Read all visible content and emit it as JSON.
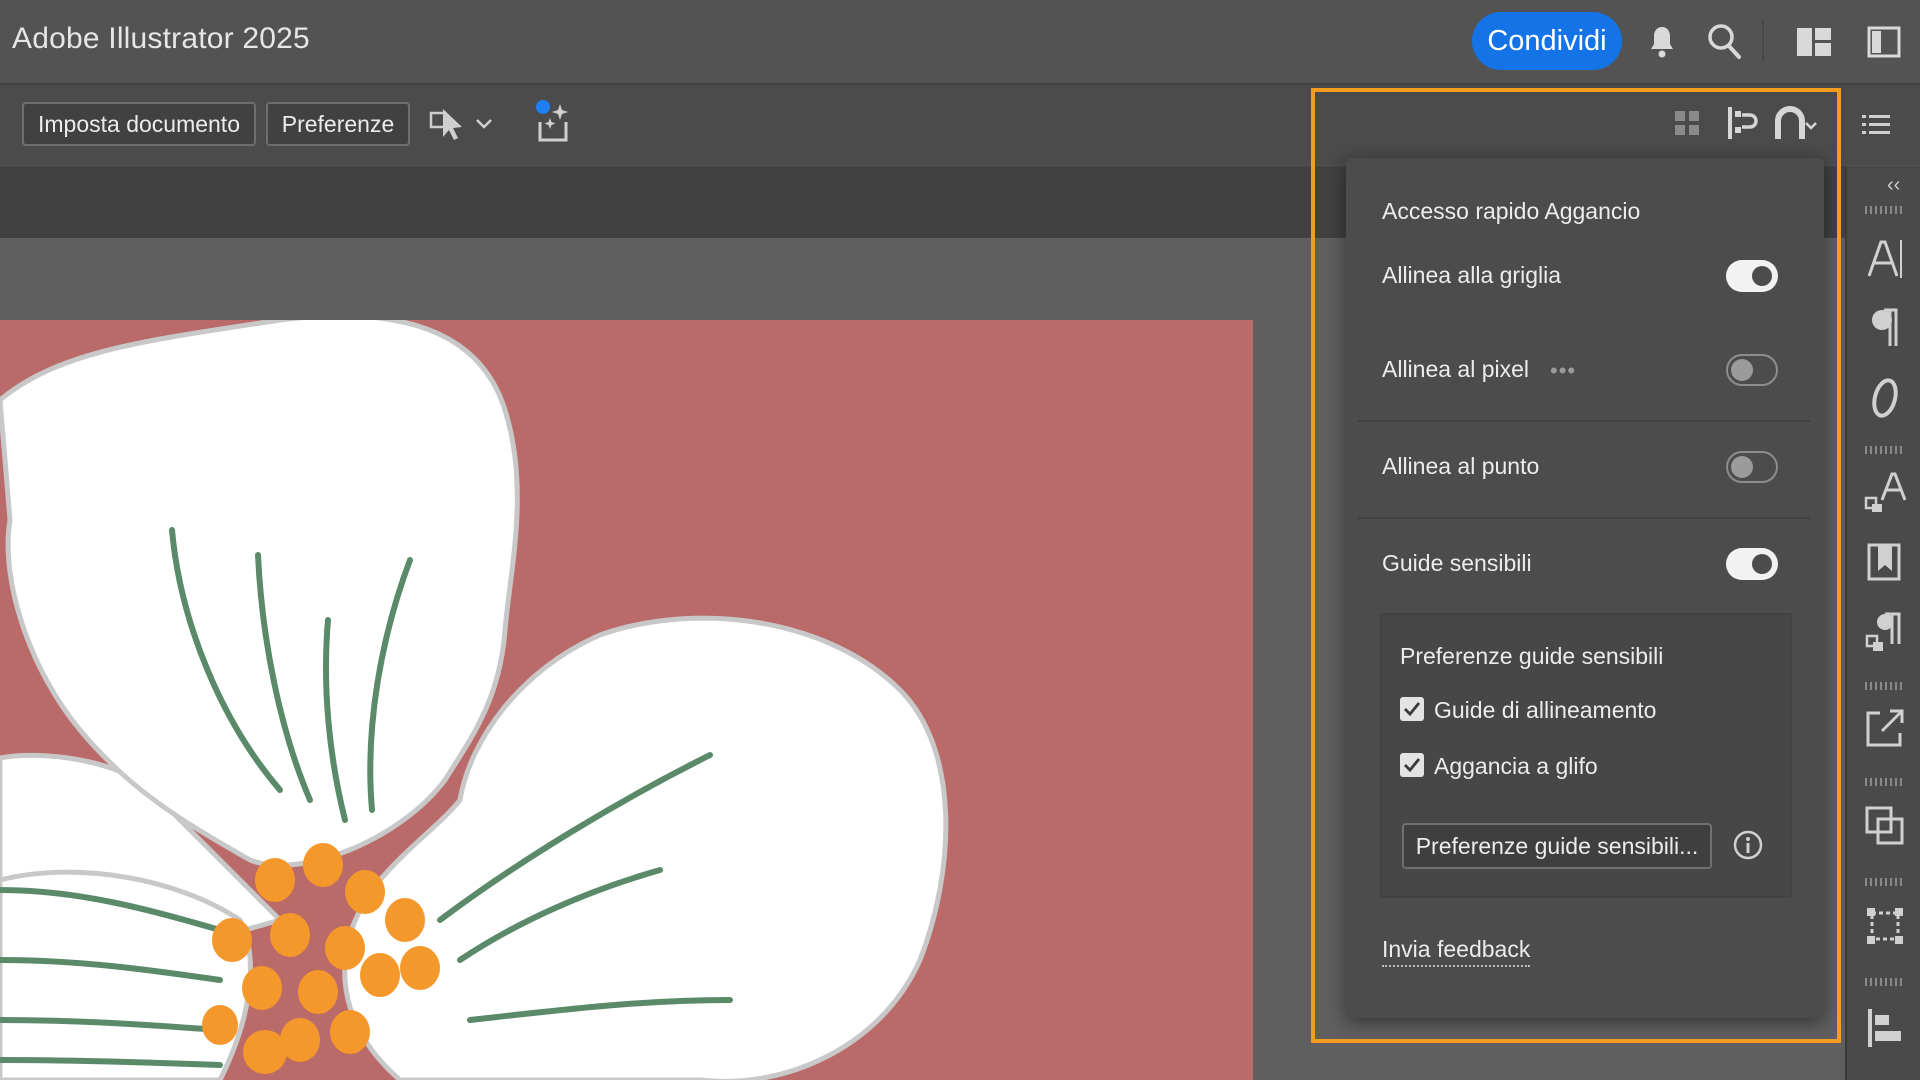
{
  "app": {
    "title": "Adobe Illustrator 2025"
  },
  "titlebar": {
    "share_label": "Condividi",
    "icons": [
      "bell-icon",
      "search-icon",
      "workspace-layout-icon",
      "panel-toggle-icon"
    ]
  },
  "controlbar": {
    "doc_setup_label": "Imposta documento",
    "prefs_label": "Preferenze",
    "icons": [
      "select-similar-icon",
      "chevron-down-icon",
      "generative-recolor-icon",
      "snap-grid-icon",
      "snap-align-icon",
      "magnet-snap-icon",
      "properties-list-icon"
    ]
  },
  "snap_popup": {
    "title": "Accesso rapido Aggancio",
    "items": [
      {
        "label": "Allinea alla griglia",
        "on": true
      },
      {
        "label": "Allinea al pixel",
        "on": false
      },
      {
        "label": "Allinea al punto",
        "on": false
      },
      {
        "label": "Guide sensibili",
        "on": true
      }
    ],
    "smart_guides": {
      "title": "Preferenze guide sensibili",
      "options": [
        {
          "label": "Guide di allineamento",
          "checked": true
        },
        {
          "label": "Aggancia a glifo",
          "checked": true
        }
      ],
      "button_label": "Preferenze guide sensibili..."
    },
    "feedback_label": "Invia feedback"
  },
  "dock": {
    "icons": [
      "character-icon",
      "paragraph-icon",
      "opentype-icon",
      "character-styles-icon",
      "paragraph-styles-icon",
      "glyph-styles-icon",
      "export-icon",
      "arrange-icon",
      "transform-icon",
      "align-icon"
    ]
  },
  "colors": {
    "accent": "#1473e6",
    "highlight": "#f39c1f",
    "artboard": "#b96a69",
    "petal_stroke": "#c8c8c8",
    "stamen": "#f5982b",
    "vein": "#5a8a6a"
  }
}
